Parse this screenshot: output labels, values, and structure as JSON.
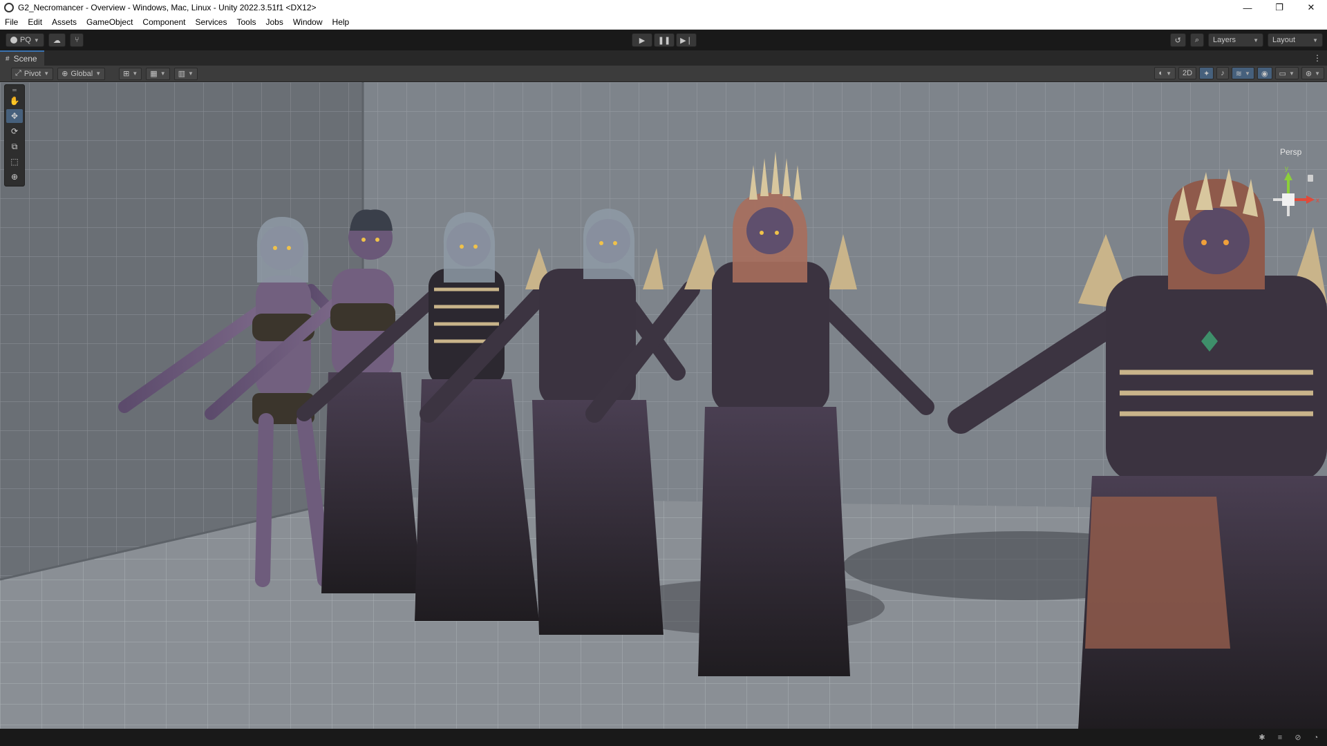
{
  "window": {
    "title": "G2_Necromancer - Overview - Windows, Mac, Linux - Unity 2022.3.51f1 <DX12>",
    "controls": [
      "—",
      "❐",
      "✕"
    ]
  },
  "menu": [
    "File",
    "Edit",
    "Assets",
    "GameObject",
    "Component",
    "Services",
    "Tools",
    "Jobs",
    "Window",
    "Help"
  ],
  "toolbar": {
    "account_label": "PQ",
    "layers_label": "Layers",
    "layout_label": "Layout"
  },
  "tab": {
    "label": "Scene"
  },
  "scene_toolbar": {
    "pivot_label": "Pivot",
    "global_label": "Global",
    "twod_label": "2D"
  },
  "viewport": {
    "camera_label": "Persp",
    "characters": 6
  },
  "colors": {
    "skin": "#6b5a7a",
    "robe": "#3c3441",
    "bone": "#c9b48a",
    "dark": "#2a2628",
    "accent": "#3a72b0"
  }
}
